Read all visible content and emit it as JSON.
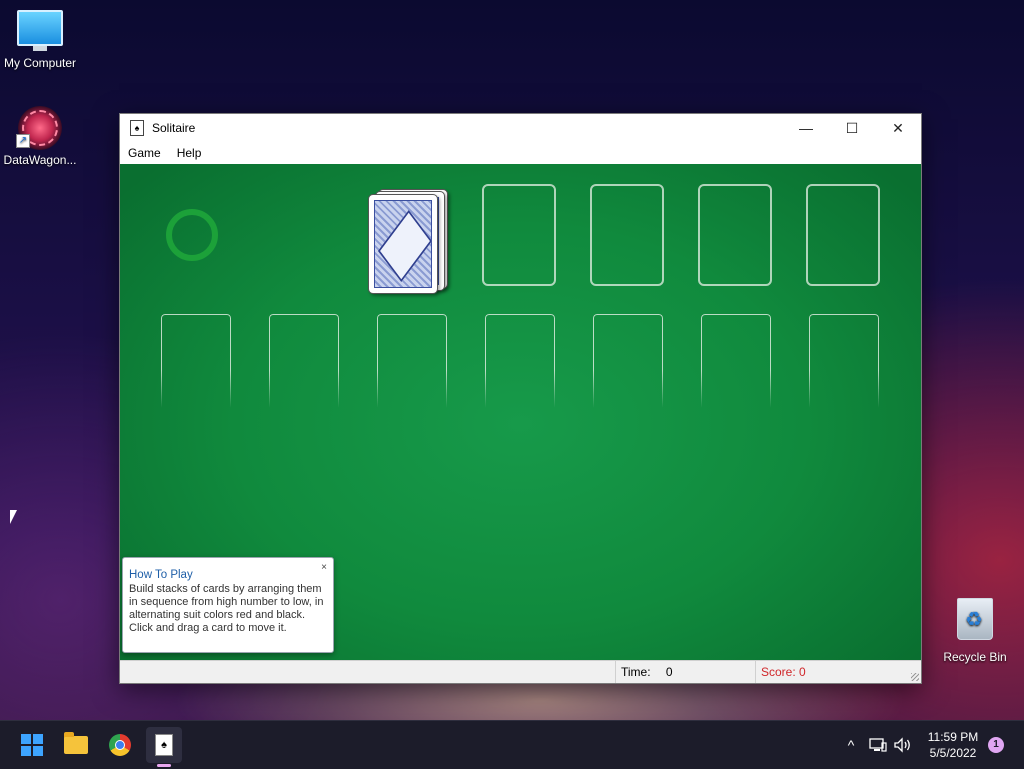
{
  "desktop": {
    "icons": [
      {
        "label": "My Computer",
        "icon": "monitor-icon"
      },
      {
        "label": "DataWagon...",
        "icon": "datawagon-icon"
      },
      {
        "label": "Recycle Bin",
        "icon": "recycle-bin-icon"
      }
    ]
  },
  "window": {
    "title": "Solitaire",
    "icon": "solitaire-card-icon",
    "controls": {
      "minimize": "—",
      "maximize": "☐",
      "close": "✕"
    },
    "menu": [
      "Game",
      "Help"
    ]
  },
  "game": {
    "how_to_play": {
      "title": "How To Play",
      "body": "Build stacks of cards by arranging them in sequence from high number to low, in alternating suit colors red and black. Click and drag a card to move it.",
      "close": "×"
    },
    "status": {
      "time_label": "Time:",
      "time_value": "0",
      "score_text": "Score: 0"
    },
    "colors": {
      "felt": "#108a3d",
      "score": "#d0262a"
    }
  },
  "taskbar": {
    "pinned": [
      "start-icon",
      "file-explorer-icon",
      "chrome-icon",
      "solitaire-icon"
    ],
    "tray": {
      "chevron": "^",
      "network": "network-icon",
      "volume": "volume-icon",
      "time": "11:59 PM",
      "date": "5/5/2022",
      "notifications": "1"
    }
  }
}
